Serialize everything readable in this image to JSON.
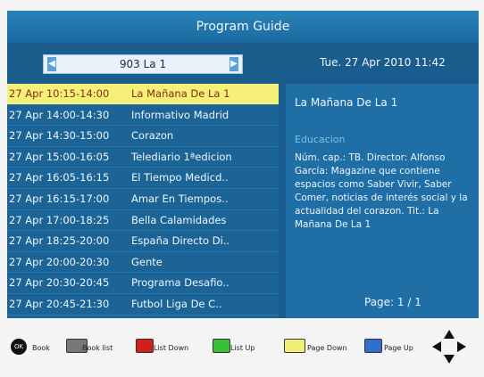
{
  "header": {
    "title": "Program Guide"
  },
  "channel": {
    "name": "903 La 1",
    "left_arrow": "◀",
    "right_arrow": "▶"
  },
  "datetime": "Tue.  27 Apr 2010 11:42",
  "programs": [
    {
      "time": "27 Apr 10:15-14:00",
      "title": "La Mañana De La 1",
      "selected": true
    },
    {
      "time": "27 Apr 14:00-14:30",
      "title": "Informativo  Madrid"
    },
    {
      "time": "27 Apr 14:30-15:00",
      "title": "Corazon"
    },
    {
      "time": "27 Apr 15:00-16:05",
      "title": "Telediario 1ªedicion"
    },
    {
      "time": "27 Apr 16:05-16:15",
      "title": "El Tiempo Medicd.."
    },
    {
      "time": "27 Apr 16:15-17:00",
      "title": "Amar En Tiempos.."
    },
    {
      "time": "27 Apr 17:00-18:25",
      "title": "Bella Calamidades"
    },
    {
      "time": "27 Apr 18:25-20:00",
      "title": "España Directo Di.."
    },
    {
      "time": "27 Apr 20:00-20:30",
      "title": "Gente"
    },
    {
      "time": "27 Apr 20:30-20:45",
      "title": "Programa Desafio.."
    },
    {
      "time": "27 Apr 20:45-21:30",
      "title": "Futbol Liga De C.."
    }
  ],
  "detail": {
    "title": "La Mañana De La 1",
    "genre": "Educacion",
    "description": "Núm. cap.: TB. Director: Alfonso García: Magazine que contiene espacios como Saber Vivir, Saber Comer, noticias de interés social y la actualidad del corazon. Tit.: La Mañana De La 1",
    "page": "Page: 1 / 1"
  },
  "legend": {
    "ok_key": "OK",
    "book": "Book",
    "book_list": "Book list",
    "list_down": "List Down",
    "list_up": "List Up",
    "page_down": "Page Down",
    "page_up": "Page Up",
    "colors": {
      "red": "#d41e1e",
      "green": "#35c235",
      "yellow": "#f1ef77",
      "blue": "#2f6fd0"
    }
  }
}
